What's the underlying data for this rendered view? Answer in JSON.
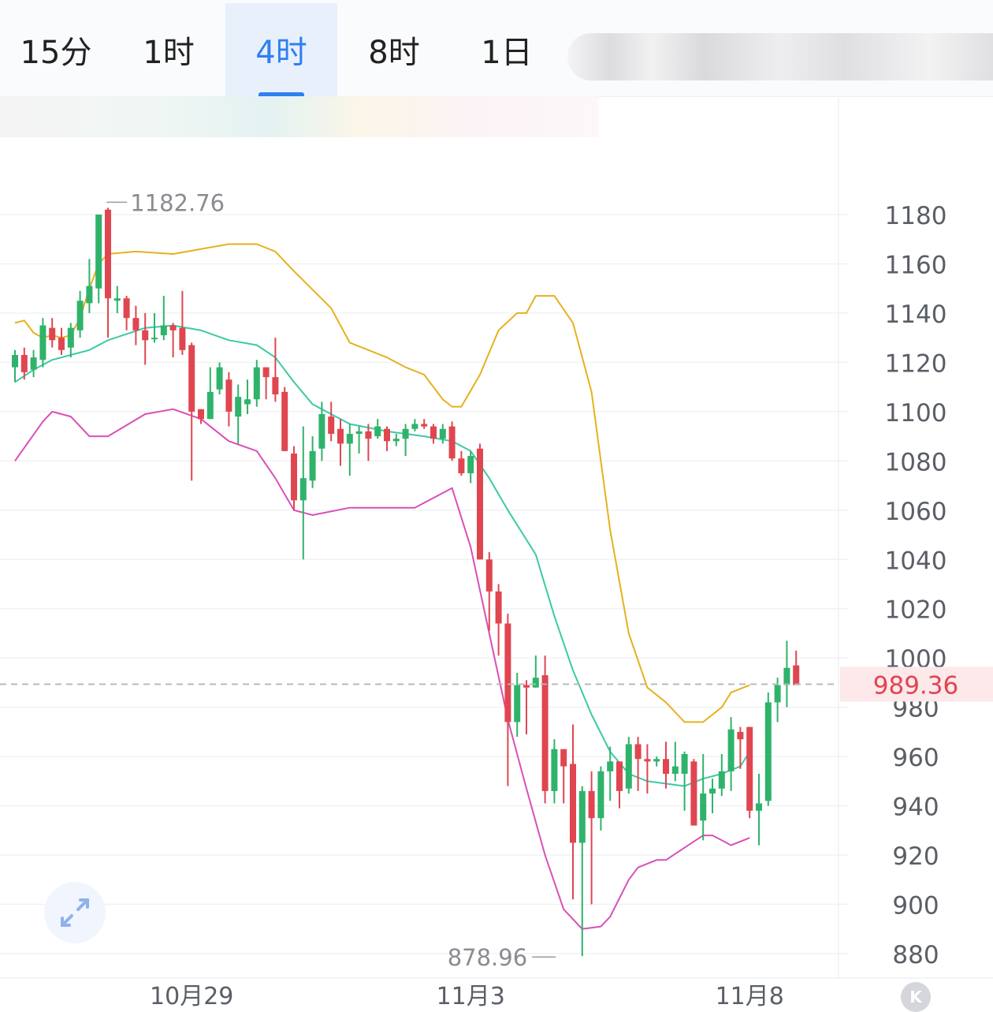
{
  "tabs": [
    {
      "label": "15分",
      "active": false
    },
    {
      "label": "1时",
      "active": false
    },
    {
      "label": "4时",
      "active": true
    },
    {
      "label": "8时",
      "active": false
    },
    {
      "label": "1日",
      "active": false
    }
  ],
  "colors": {
    "accent": "#2f7ff0",
    "up": "#2fb36b",
    "down": "#e04650",
    "band_upper": "#e6b11d",
    "band_middle": "#3cc9a6",
    "band_lower": "#d94fb8",
    "price_label": "#e04650",
    "price_label_bg": "#fde8ea"
  },
  "chart_data": {
    "type": "candlestick",
    "y_axis": {
      "min": 880,
      "max": 1180,
      "step": 20,
      "ticks": [
        "1180",
        "1160",
        "1140",
        "1120",
        "1100",
        "1080",
        "1060",
        "1040",
        "1020",
        "1000",
        "980",
        "960",
        "940",
        "920",
        "900",
        "880"
      ]
    },
    "x_labels": [
      {
        "label": "10月29",
        "index": 19
      },
      {
        "label": "11月3",
        "index": 49
      },
      {
        "label": "11月8",
        "index": 79
      }
    ],
    "last_price": "989.36",
    "last_value": 989.36,
    "high_label": {
      "text": "1182.76",
      "value": 1182.76,
      "index": 9
    },
    "low_label": {
      "text": "878.96",
      "value": 878.96,
      "index": 59
    },
    "candles": [
      [
        1118,
        1123,
        1125,
        1112
      ],
      [
        1123,
        1116,
        1126,
        1113
      ],
      [
        1117,
        1122,
        1125,
        1114
      ],
      [
        1121,
        1135,
        1138,
        1118
      ],
      [
        1134,
        1129,
        1138,
        1126
      ],
      [
        1130,
        1125,
        1134,
        1123
      ],
      [
        1126,
        1134,
        1136,
        1122
      ],
      [
        1133,
        1145,
        1149,
        1130
      ],
      [
        1144,
        1151,
        1162,
        1140
      ],
      [
        1150,
        1180,
        1180,
        1144
      ],
      [
        1182,
        1146,
        1182.76,
        1130
      ],
      [
        1145,
        1146,
        1151,
        1140
      ],
      [
        1146,
        1138,
        1147,
        1133
      ],
      [
        1138,
        1133,
        1143,
        1127
      ],
      [
        1133,
        1129,
        1140,
        1119
      ],
      [
        1130,
        1130,
        1140,
        1128
      ],
      [
        1131,
        1135,
        1147,
        1129
      ],
      [
        1135,
        1133,
        1136,
        1122
      ],
      [
        1134,
        1125,
        1149,
        1123
      ],
      [
        1127,
        1100,
        1128,
        1072
      ],
      [
        1101,
        1097,
        1101,
        1095
      ],
      [
        1097,
        1108,
        1118,
        1097
      ],
      [
        1109,
        1118,
        1120,
        1107
      ],
      [
        1113,
        1100,
        1116,
        1094
      ],
      [
        1098,
        1106,
        1111,
        1087
      ],
      [
        1103,
        1105,
        1113,
        1099
      ],
      [
        1105,
        1118,
        1121,
        1102
      ],
      [
        1118,
        1114,
        1118,
        1105
      ],
      [
        1114,
        1107,
        1130,
        1104
      ],
      [
        1108,
        1084,
        1110,
        1084
      ],
      [
        1083,
        1064,
        1086,
        1060
      ],
      [
        1064,
        1073,
        1094,
        1040
      ],
      [
        1072,
        1084,
        1090,
        1069
      ],
      [
        1085,
        1099,
        1104,
        1080
      ],
      [
        1098,
        1091,
        1104,
        1088
      ],
      [
        1093,
        1087,
        1097,
        1078
      ],
      [
        1087,
        1091,
        1095,
        1074
      ],
      [
        1091,
        1092,
        1094,
        1083
      ],
      [
        1092,
        1089,
        1095,
        1080
      ],
      [
        1090,
        1094,
        1097,
        1089
      ],
      [
        1093,
        1088,
        1094,
        1084
      ],
      [
        1088,
        1089,
        1091,
        1086
      ],
      [
        1089,
        1093,
        1095,
        1082
      ],
      [
        1093,
        1095,
        1097,
        1092
      ],
      [
        1095,
        1094,
        1097,
        1093
      ],
      [
        1094,
        1089,
        1095,
        1087
      ],
      [
        1089,
        1093,
        1095,
        1087
      ],
      [
        1094,
        1081,
        1096,
        1080
      ],
      [
        1081,
        1075,
        1084,
        1074
      ],
      [
        1075,
        1082,
        1084,
        1071
      ],
      [
        1085,
        1040,
        1087,
        1040
      ],
      [
        1040,
        1027,
        1043,
        1011
      ],
      [
        1027,
        1014,
        1030,
        1001
      ],
      [
        1014,
        974,
        1018,
        948
      ],
      [
        974,
        989,
        994,
        968
      ],
      [
        989,
        988,
        991,
        969
      ],
      [
        988,
        992,
        1001,
        988
      ],
      [
        993,
        946,
        1001,
        941
      ],
      [
        946,
        963,
        967,
        941
      ],
      [
        963,
        956,
        963,
        941
      ],
      [
        957,
        925,
        973,
        902
      ],
      [
        925,
        946,
        948,
        879
      ],
      [
        946,
        935,
        954,
        900
      ],
      [
        935,
        954,
        956,
        930
      ],
      [
        954,
        958,
        964,
        942
      ],
      [
        958,
        946,
        958,
        939
      ],
      [
        947,
        965,
        968,
        945
      ],
      [
        965,
        959,
        968,
        946
      ],
      [
        959,
        958,
        965,
        945
      ],
      [
        958,
        959,
        960,
        956
      ],
      [
        959,
        953,
        966,
        947
      ],
      [
        953,
        956,
        966,
        950
      ],
      [
        953,
        961,
        962,
        938
      ],
      [
        958,
        932,
        959,
        932
      ],
      [
        934,
        945,
        961,
        926
      ],
      [
        945,
        947,
        951,
        937
      ],
      [
        947,
        954,
        961,
        944
      ],
      [
        954,
        971,
        976,
        946
      ],
      [
        970,
        967,
        972,
        955
      ],
      [
        972,
        938,
        972,
        935
      ],
      [
        938,
        941,
        953,
        924
      ],
      [
        942,
        982,
        986,
        940
      ],
      [
        982,
        989,
        992,
        974
      ],
      [
        989,
        996,
        1007,
        980
      ],
      [
        997,
        989,
        1003,
        989
      ]
    ],
    "bands": {
      "upper": [
        [
          0,
          1136
        ],
        [
          1,
          1137
        ],
        [
          2,
          1132
        ],
        [
          3,
          1130
        ],
        [
          4,
          1131
        ],
        [
          5,
          1130
        ],
        [
          6,
          1131
        ],
        [
          7,
          1138
        ],
        [
          8,
          1150
        ],
        [
          9,
          1160
        ],
        [
          10,
          1164
        ],
        [
          13,
          1165
        ],
        [
          17,
          1164
        ],
        [
          20,
          1166
        ],
        [
          23,
          1168
        ],
        [
          26,
          1168
        ],
        [
          28,
          1165
        ],
        [
          30,
          1157
        ],
        [
          34,
          1142
        ],
        [
          36,
          1128
        ],
        [
          40,
          1122
        ],
        [
          42,
          1118
        ],
        [
          44,
          1115
        ],
        [
          46,
          1105
        ],
        [
          47,
          1102
        ],
        [
          48,
          1102
        ],
        [
          50,
          1115
        ],
        [
          52,
          1133
        ],
        [
          54,
          1140
        ],
        [
          55,
          1140
        ],
        [
          56,
          1147
        ],
        [
          58,
          1147
        ],
        [
          60,
          1136
        ],
        [
          62,
          1108
        ],
        [
          64,
          1052
        ],
        [
          66,
          1010
        ],
        [
          68,
          988
        ],
        [
          70,
          982
        ],
        [
          72,
          974
        ],
        [
          74,
          974
        ],
        [
          76,
          980
        ],
        [
          77,
          986
        ],
        [
          79,
          989
        ]
      ],
      "middle": [
        [
          0,
          1112
        ],
        [
          2,
          1117
        ],
        [
          4,
          1121
        ],
        [
          6,
          1123
        ],
        [
          8,
          1125
        ],
        [
          10,
          1129
        ],
        [
          14,
          1134
        ],
        [
          17,
          1135
        ],
        [
          20,
          1133
        ],
        [
          23,
          1129
        ],
        [
          26,
          1127
        ],
        [
          28,
          1122
        ],
        [
          30,
          1112
        ],
        [
          32,
          1103
        ],
        [
          36,
          1095
        ],
        [
          40,
          1092
        ],
        [
          44,
          1090
        ],
        [
          47,
          1088
        ],
        [
          49,
          1084
        ],
        [
          51,
          1073
        ],
        [
          53,
          1060
        ],
        [
          56,
          1042
        ],
        [
          58,
          1017
        ],
        [
          60,
          995
        ],
        [
          62,
          977
        ],
        [
          64,
          962
        ],
        [
          66,
          953
        ],
        [
          68,
          950
        ],
        [
          70,
          949
        ],
        [
          72,
          948
        ],
        [
          74,
          951
        ],
        [
          76,
          953
        ],
        [
          78,
          956
        ],
        [
          79,
          962
        ]
      ],
      "lower": [
        [
          0,
          1080
        ],
        [
          3,
          1096
        ],
        [
          4,
          1100
        ],
        [
          6,
          1098
        ],
        [
          8,
          1090
        ],
        [
          10,
          1090
        ],
        [
          14,
          1099
        ],
        [
          17,
          1101
        ],
        [
          20,
          1097
        ],
        [
          23,
          1088
        ],
        [
          26,
          1084
        ],
        [
          28,
          1073
        ],
        [
          30,
          1060
        ],
        [
          32,
          1058
        ],
        [
          36,
          1061
        ],
        [
          40,
          1061
        ],
        [
          43,
          1061
        ],
        [
          45,
          1065
        ],
        [
          47,
          1069
        ],
        [
          49,
          1045
        ],
        [
          51,
          1010
        ],
        [
          53,
          975
        ],
        [
          55,
          947
        ],
        [
          57,
          920
        ],
        [
          59,
          898
        ],
        [
          61,
          890
        ],
        [
          63,
          891
        ],
        [
          64,
          895
        ],
        [
          66,
          910
        ],
        [
          67,
          915
        ],
        [
          69,
          918
        ],
        [
          70,
          918
        ],
        [
          72,
          923
        ],
        [
          74,
          928
        ],
        [
          75,
          928
        ],
        [
          76,
          926
        ],
        [
          77,
          924
        ],
        [
          79,
          927
        ]
      ]
    }
  }
}
